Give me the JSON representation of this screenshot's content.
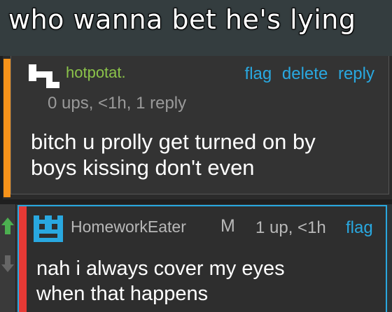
{
  "meme_caption": "who wanna bet he's lying",
  "colors": {
    "accent_blue": "#29a8e0",
    "username_green": "#8bc34a",
    "orange_bar": "#f7931a",
    "red_bar": "#e53935",
    "upvote_green": "#4caf50"
  },
  "comment_parent": {
    "username": "hotpotat.",
    "actions": [
      "flag",
      "delete",
      "reply"
    ],
    "meta": "0 ups, <1h, 1 reply",
    "body_lines": [
      "bitch u prolly get turned on by",
      "boys kissing don't even"
    ]
  },
  "comment_reply": {
    "username": "HomeworkEater",
    "badge": "M",
    "meta": "1 up, <1h",
    "flag_label": "flag",
    "body_lines": [
      "nah i always cover my eyes",
      "when that happens"
    ]
  },
  "icons": {
    "avatar_parent": "pixel-avatar-icon",
    "avatar_reply": "pixel-robot-avatar-icon",
    "upvote": "up-arrow-icon",
    "downvote": "down-arrow-icon"
  }
}
